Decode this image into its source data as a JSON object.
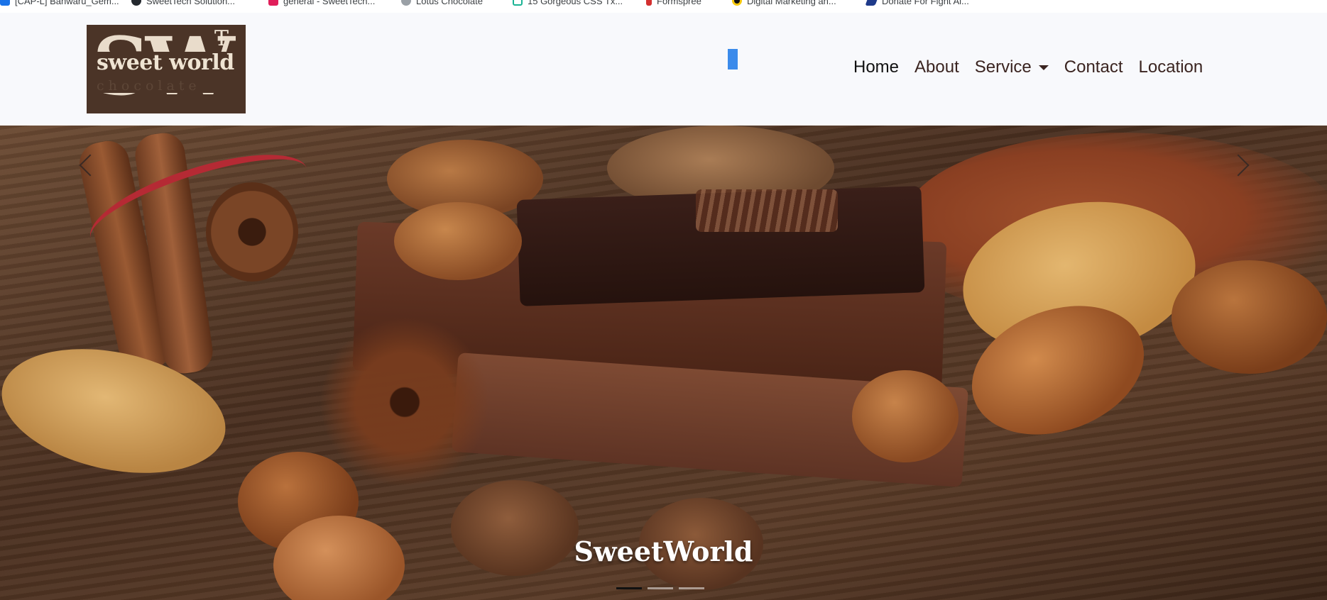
{
  "bookmarks": [
    {
      "label": "[CAP-L] Banwaru_Gem...",
      "icon": "blue-check-icon",
      "color": "#1a73e8"
    },
    {
      "label": "SweetTech Solution...",
      "icon": "github-icon",
      "color": "#24292e"
    },
    {
      "label": "general - SweetTech...",
      "icon": "slack-icon",
      "color": "#e01e5a"
    },
    {
      "label": "Lotus Chocolate",
      "icon": "globe-icon",
      "color": "#9aa0a6"
    },
    {
      "label": "15 Gorgeous CSS Tx...",
      "icon": "codepen-icon",
      "color": "#1ab394"
    },
    {
      "label": "Formspree",
      "icon": "formspree-icon",
      "color": "#d32f2f"
    },
    {
      "label": "Digital Marketing an...",
      "icon": "dm-icon",
      "color": "#f6c90e"
    },
    {
      "label": "Donate For Fight Ai...",
      "icon": "donate-icon",
      "color": "#1e3a8a"
    }
  ],
  "logo": {
    "monogram": "SW",
    "brand": "sweet world",
    "sub": "chocolate",
    "mark": "T"
  },
  "nav": {
    "items": [
      {
        "label": "Home"
      },
      {
        "label": "About"
      },
      {
        "label": "Service"
      },
      {
        "label": "Contact"
      },
      {
        "label": "Location"
      }
    ]
  },
  "hero": {
    "caption": "SweetWorld",
    "slides": 3,
    "active_slide": 1
  },
  "colors": {
    "nav_text": "#3a2420",
    "logo_bg": "#4b3427",
    "marker": "#3b8beb"
  }
}
